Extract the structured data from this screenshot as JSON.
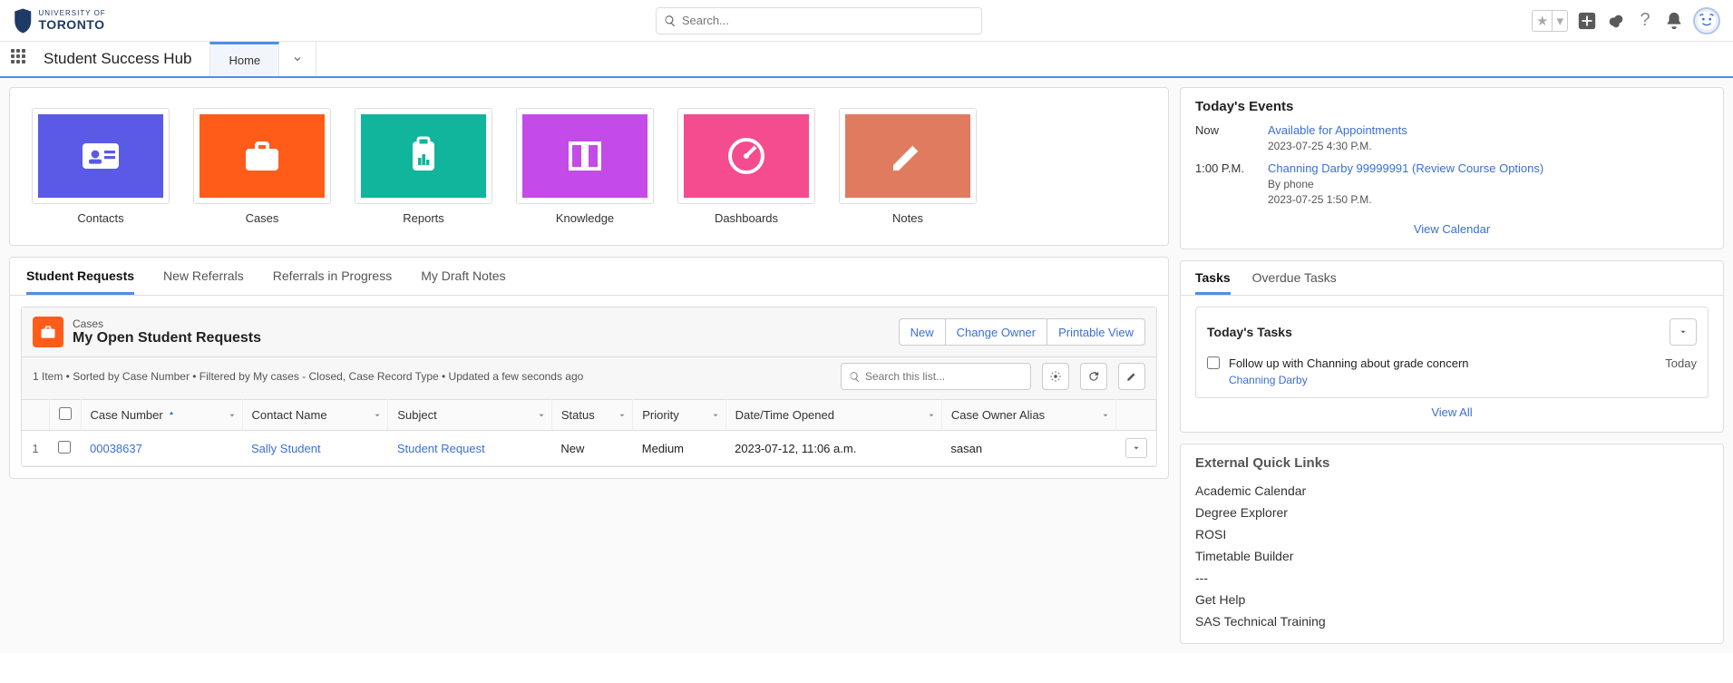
{
  "header": {
    "org": "UNIVERSITY OF",
    "org2": "TORONTO",
    "search_placeholder": "Search..."
  },
  "nav": {
    "app_title": "Student Success Hub",
    "home_tab": "Home"
  },
  "tiles": [
    {
      "label": "Contacts",
      "color": "#5a5ae6"
    },
    {
      "label": "Cases",
      "color": "#ff5c1a"
    },
    {
      "label": "Reports",
      "color": "#10b59b"
    },
    {
      "label": "Knowledge",
      "color": "#c44be8"
    },
    {
      "label": "Dashboards",
      "color": "#f44c8f"
    },
    {
      "label": "Notes",
      "color": "#e07b5f"
    }
  ],
  "sr_tabs": [
    "Student Requests",
    "New Referrals",
    "Referrals in Progress",
    "My Draft Notes"
  ],
  "listview": {
    "suptitle": "Cases",
    "title": "My Open Student Requests",
    "meta": "1 Item • Sorted by Case Number • Filtered by My cases - Closed, Case Record Type • Updated a few seconds ago",
    "actions": {
      "new": "New",
      "change_owner": "Change Owner",
      "printable": "Printable View"
    },
    "search_placeholder": "Search this list...",
    "columns": [
      "Case Number",
      "Contact Name",
      "Subject",
      "Status",
      "Priority",
      "Date/Time Opened",
      "Case Owner Alias"
    ],
    "rows": [
      {
        "num": "1",
        "case_number": "00038637",
        "contact": "Sally Student",
        "subject": "Student Request",
        "status": "New",
        "priority": "Medium",
        "opened": "2023-07-12, 11:06 a.m.",
        "owner": "sasan"
      }
    ]
  },
  "events": {
    "title": "Today's Events",
    "items": [
      {
        "time": "Now",
        "link": "Available for Appointments",
        "sub1": "2023-07-25 4:30 P.M."
      },
      {
        "time": "1:00 P.M.",
        "link": "Channing Darby 99999991 (Review Course Options)",
        "sub1": "By phone",
        "sub2": "2023-07-25 1:50 P.M."
      }
    ],
    "view_all": "View Calendar"
  },
  "tasks": {
    "tabs": [
      "Tasks",
      "Overdue Tasks"
    ],
    "title": "Today's Tasks",
    "items": [
      {
        "text": "Follow up with Channing about grade concern",
        "related": "Channing Darby",
        "date": "Today"
      }
    ],
    "view_all": "View All"
  },
  "quick_links": {
    "title": "External Quick Links",
    "items": [
      "Academic Calendar",
      "Degree Explorer",
      "ROSI",
      "Timetable Builder",
      "---",
      "Get Help",
      "SAS Technical Training"
    ]
  }
}
